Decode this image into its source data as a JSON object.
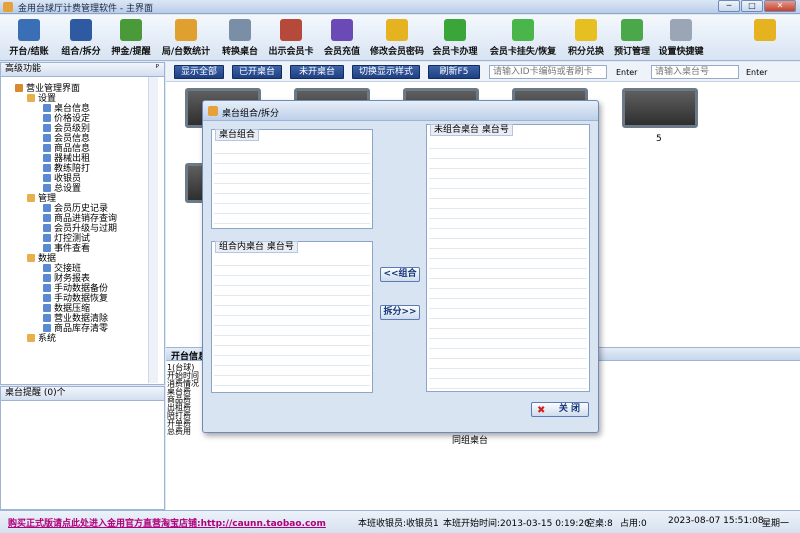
{
  "window": {
    "title": "金用台球厅计费管理软件 - 主界面",
    "min": "─",
    "max": "□",
    "close": "✕"
  },
  "toolbar": [
    {
      "label": "开台/结账",
      "icon": "monitor-icon",
      "color": "#3a6fb5"
    },
    {
      "label": "组合/拆分",
      "icon": "grid-icon",
      "color": "#2d5aa0"
    },
    {
      "label": "押金/提醒",
      "icon": "money-icon",
      "color": "#4a9a3a"
    },
    {
      "label": "局/台数统计",
      "icon": "chart-icon",
      "color": "#e0a030"
    },
    {
      "label": "转换桌台",
      "icon": "switch-icon",
      "color": "#7a8ea6"
    },
    {
      "label": "出示会员卡",
      "icon": "person-card-icon",
      "color": "#b54a3a"
    },
    {
      "label": "会员充值",
      "icon": "person-icon",
      "color": "#6a4ab5"
    },
    {
      "label": "修改会员密码",
      "icon": "key-icon",
      "color": "#e6b320"
    },
    {
      "label": "会员卡办理",
      "icon": "plus-icon",
      "color": "#3aa63a"
    },
    {
      "label": "会员卡挂失/恢复",
      "icon": "play-icon",
      "color": "#4ab54a"
    },
    {
      "label": "积分兑换",
      "icon": "star-icon",
      "color": "#e6c020"
    },
    {
      "label": "预订管理",
      "icon": "clock-icon",
      "color": "#4aa84a"
    },
    {
      "label": "设置快捷键",
      "icon": "keyboard-icon",
      "color": "#9aa6b6"
    },
    {
      "label": "",
      "icon": "lock-icon",
      "color": "#e6b320"
    }
  ],
  "leftpanel": {
    "title": "高级功能",
    "pin": "ᴾ",
    "root": "营业管理界面",
    "groups": [
      {
        "name": "设置",
        "items": [
          "桌台信息",
          "价格设定",
          "会员级别",
          "会员信息",
          "商品信息",
          "器械出租",
          "教练陪打",
          "收银员",
          "总设置"
        ]
      },
      {
        "name": "管理",
        "items": [
          "会员历史记录",
          "商品进销存查询",
          "会员升级与过期",
          "灯控测试",
          "事件查看"
        ]
      },
      {
        "name": "数据",
        "items": [
          "交接班",
          "财务报表",
          "手动数据备份",
          "手动数据恢复",
          "数据压缩",
          "营业数据清除",
          "商品库存清零"
        ]
      },
      {
        "name": "系统",
        "items": []
      }
    ],
    "reminder_title": "桌台提醒",
    "reminder_count": "(0)个"
  },
  "filter": {
    "show_all": "显示全部",
    "opened": "已开桌台",
    "not_opened": "未开桌台",
    "switch_style": "切换显示样式",
    "refresh": "刷新F5",
    "card_placeholder": "请输入ID卡编码或者刷卡",
    "enter1": "Enter",
    "table_placeholder": "请输入桌台号",
    "enter2": "Enter"
  },
  "tables": [
    {
      "num": ""
    },
    {
      "num": ""
    },
    {
      "num": ""
    },
    {
      "num": ""
    },
    {
      "num": "5"
    },
    {
      "num": ""
    }
  ],
  "info": {
    "tab": "开台信息",
    "lines": [
      "1(台球)",
      "开始时间",
      "消费情况",
      "桌台费",
      "商品费",
      "出租费",
      "陪打费",
      "开单费",
      "总费用"
    ],
    "group_label": "同组桌台"
  },
  "dialog": {
    "title": "桌台组合/拆分",
    "group1": "桌台组合",
    "group2": "组合内桌台  桌台号",
    "group3": "未组合桌台  桌台号",
    "combine": "<<组合",
    "split": "拆分>>",
    "close": "关   闭"
  },
  "status": {
    "link": "购买正式版请点此处进入金用官方直营淘宝店铺:http://caunn.taobao.com",
    "cashier": "本班收银员:收银员1",
    "start": "本班开始时间:2013-03-15 0:19:20",
    "empty": "空桌:8",
    "used": "占用:0",
    "datetime": "2023-08-07 15:51:08",
    "weekday": "星期一"
  }
}
